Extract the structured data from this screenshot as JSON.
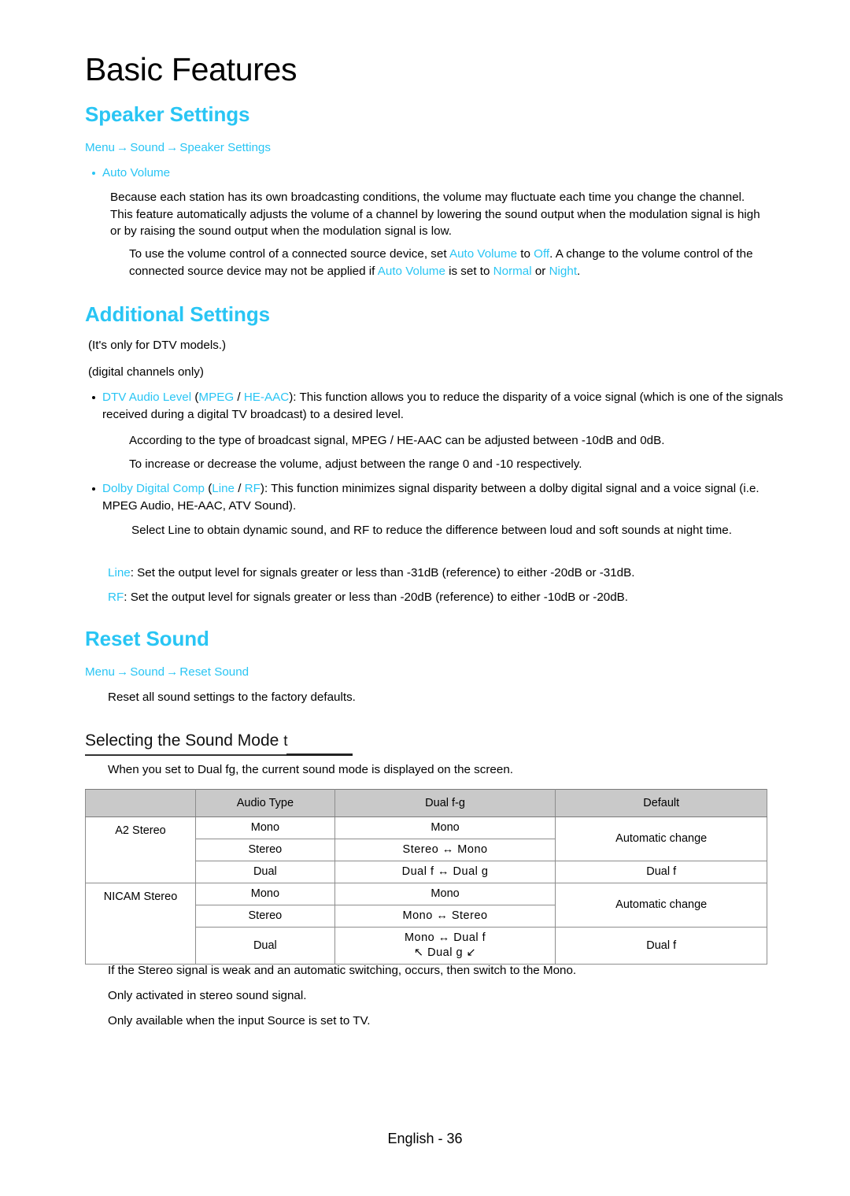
{
  "page": {
    "title": "Basic Features",
    "footer": "English - 36"
  },
  "sections": {
    "speaker_settings": {
      "heading": "Speaker Settings",
      "breadcrumb": {
        "item1": "Menu",
        "arrow1": "→",
        "item2": "Sound",
        "arrow2": "→",
        "item3": "Speaker Settings"
      },
      "bullet": "Auto Volume",
      "para1": "Because each station has its own broadcasting conditions, the volume may fluctuate each time you change the channel. This feature automatically adjusts the volume of a channel by lowering the sound output when the modulation signal is high or by raising the sound output when the modulation signal is low.",
      "para2": {
        "t1": "To use the volume control of a connected source device, set ",
        "c1": "Auto Volume",
        "t2": " to ",
        "c2": "Off",
        "t3": ". A change to the volume control of the connected source device may not be applied if ",
        "c3": "Auto Volume",
        "t4": " is set to ",
        "c4": "Normal",
        "t5": " or ",
        "c5": "Night",
        "t6": "."
      }
    },
    "additional_settings": {
      "heading": "Additional Settings",
      "note1": "(It's only for DTV models.)",
      "note2": "(digital channels only)",
      "dtv_audio_level": {
        "c1": "DTV Audio Level",
        "t1": " (",
        "c2": "MPEG",
        "t2": " / ",
        "c3": "HE-AAC",
        "t3": "): This function allows you to reduce the disparity of a voice signal (which is one of the signals received during a digital TV broadcast) to a desired level."
      },
      "dtv_sub1": "According to the type of broadcast signal, MPEG / HE-AAC can be adjusted between -10dB and 0dB.",
      "dtv_sub2": "To increase or decrease the volume, adjust between the range 0 and -10 respectively.",
      "dolby_digital_comp": {
        "c1": "Dolby Digital Comp",
        "t1": " (",
        "c2": "Line",
        "t2": " / ",
        "c3": "RF",
        "t3": "): This function minimizes signal disparity between a dolby digital signal and a voice signal (i.e. MPEG Audio, HE-AAC, ATV Sound)."
      },
      "dolby_sub1": "Select Line to obtain dynamic sound, and RF to reduce the difference between loud and soft sounds at night time.",
      "line_def": {
        "c1": "Line",
        "t1": ": Set the output level for signals greater or less than -31dB (reference) to either -20dB or -31dB."
      },
      "rf_def": {
        "c1": "RF",
        "t1": ": Set the output level for signals greater or less than -20dB (reference) to either -10dB or -20dB."
      }
    },
    "reset_sound": {
      "heading": "Reset Sound",
      "breadcrumb": {
        "item1": "Menu",
        "arrow1": "→",
        "item2": "Sound",
        "arrow2": "→",
        "item3": "Reset Sound"
      },
      "para1": "Reset all sound settings to the factory defaults."
    },
    "sound_mode": {
      "heading": "Selecting the Sound Mode",
      "heading_suffix": "t",
      "intro": "When you set to Dual fg, the current sound mode is displayed on the screen.",
      "notes": [
        "If the Stereo signal is weak and an automatic switching, occurs, then switch to the Mono.",
        "Only activated in stereo sound signal.",
        "Only available when the input Source is set to TV."
      ]
    }
  },
  "table": {
    "headers": [
      "",
      "Audio Type",
      "Dual f-g",
      "Default"
    ],
    "rows": [
      {
        "group": "A2 Stereo",
        "audio_type": "Mono",
        "dual": "Mono",
        "default": "Automatic change"
      },
      {
        "group": "",
        "audio_type": "Stereo",
        "dual": "Stereo ↔ Mono",
        "default": ""
      },
      {
        "group": "",
        "audio_type": "Dual",
        "dual": "Dual f ↔ Dual g",
        "default": "Dual f"
      },
      {
        "group": "NICAM Stereo",
        "audio_type": "Mono",
        "dual": "Mono",
        "default": "Automatic change"
      },
      {
        "group": "",
        "audio_type": "Stereo",
        "dual": "Mono ↔ Stereo",
        "default": ""
      },
      {
        "group": "",
        "audio_type": "Dual",
        "dual": "Mono ↔ Dual f",
        "dual_line2": "↖ Dual g ↙",
        "default": "Dual f"
      }
    ]
  },
  "colors": {
    "accent": "#29c5f4",
    "text": "#000000",
    "table_header_bg": "#c9c9c9",
    "table_border": "#8d8d8d"
  }
}
